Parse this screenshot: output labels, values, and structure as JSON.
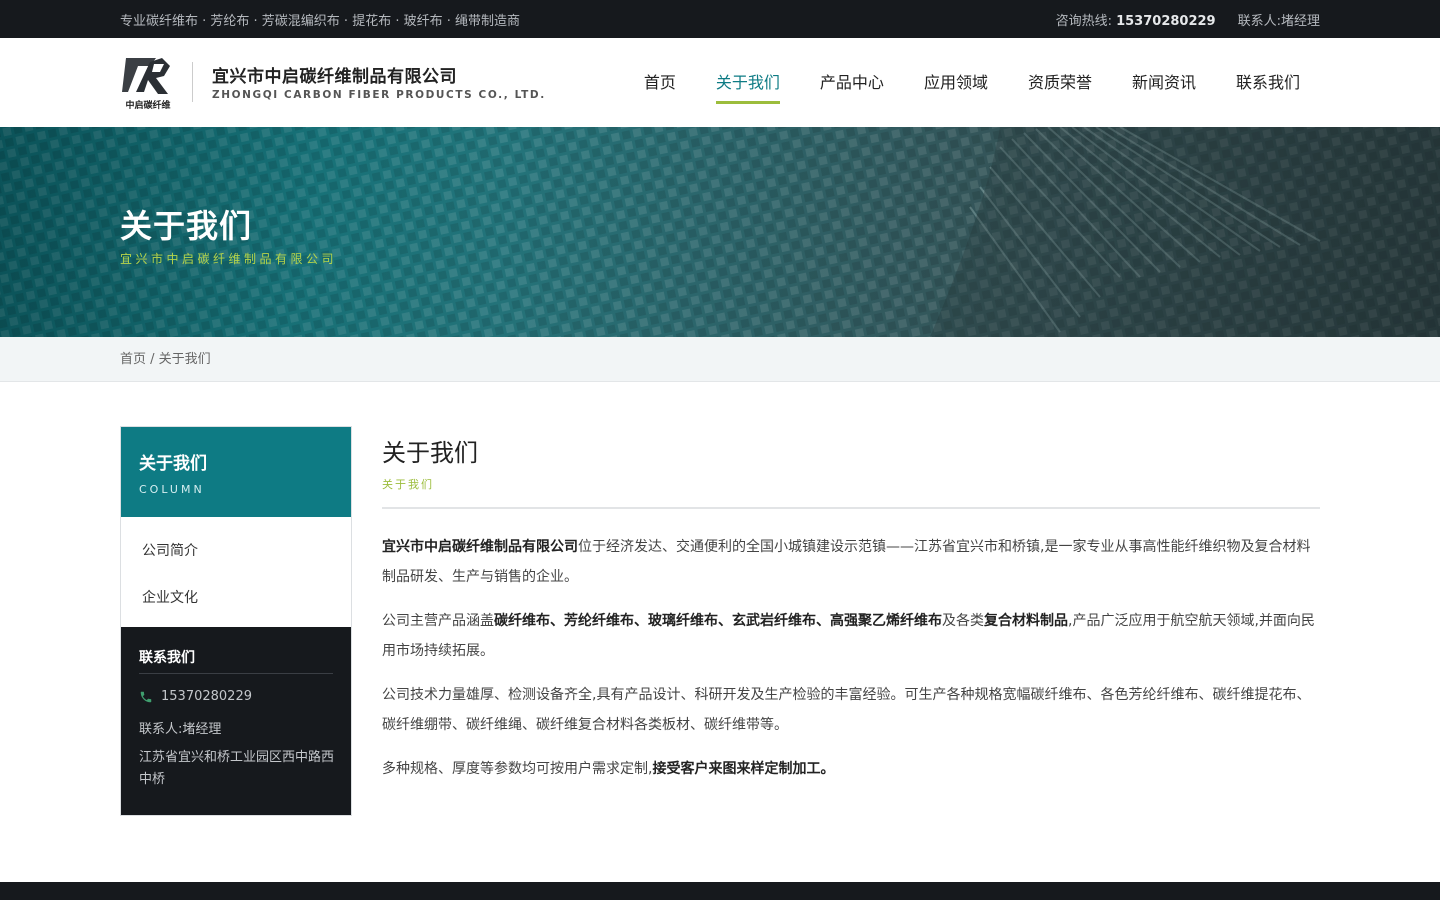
{
  "topbar": {
    "tagline": "专业碳纤维布 · 芳纶布 · 芳碳混编织布 · 提花布 · 玻纤布 · 绳带制造商",
    "hotline_label": "咨询热线:",
    "hotline_number": "15370280229",
    "contact_label": "联系人:",
    "contact_name": "堵经理"
  },
  "header": {
    "logo_caption": "中启碳纤维",
    "company_cn": "宜兴市中启碳纤维制品有限公司",
    "company_en": "ZHONGQI CARBON FIBER PRODUCTS CO., LTD.",
    "nav": [
      {
        "label": "首页",
        "active": false
      },
      {
        "label": "关于我们",
        "active": true
      },
      {
        "label": "产品中心",
        "active": false
      },
      {
        "label": "应用领域",
        "active": false
      },
      {
        "label": "资质荣誉",
        "active": false
      },
      {
        "label": "新闻资讯",
        "active": false
      },
      {
        "label": "联系我们",
        "active": false
      }
    ]
  },
  "banner": {
    "title": "关于我们",
    "subtitle": "宜兴市中启碳纤维制品有限公司"
  },
  "breadcrumb": {
    "home": "首页",
    "separator": " / ",
    "current": "关于我们"
  },
  "sidebar": {
    "title": "关于我们",
    "title_en": "COLUMN",
    "links": [
      "公司简介",
      "企业文化"
    ],
    "contact": {
      "title": "联系我们",
      "phone": "15370280229",
      "person": "联系人:堵经理",
      "address": "江苏省宜兴和桥工业园区西中路西中桥"
    }
  },
  "main": {
    "title": "关于我们",
    "subtitle": "关于我们",
    "p1": {
      "company": "宜兴市中启碳纤维制品有限公司",
      "text": "位于经济发达、交通便利的全国小城镇建设示范镇——江苏省宜兴市和桥镇,是一家专业从事高性能纤维织物及复合材料制品研发、生产与销售的企业。"
    },
    "p2": {
      "pre": "公司主营产品涵盖",
      "products": "碳纤维布、芳纶纤维布、玻璃纤维布、玄武岩纤维布、高强聚乙烯纤维布",
      "mid": "及各类",
      "composite": "复合材料制品",
      "post": ",产品广泛应用于航空航天领域,并面向民用市场持续拓展。"
    },
    "p3": "公司技术力量雄厚、检测设备齐全,具有产品设计、科研开发及生产检验的丰富经验。可生产各种规格宽幅碳纤维布、各色芳纶纤维布、碳纤维提花布、碳纤维绷带、碳纤维绳、碳纤维复合材料各类板材、碳纤维带等。",
    "p4": {
      "text": "多种规格、厚度等参数均可按用户需求定制,",
      "bold": "接受客户来图来样定制加工。"
    }
  },
  "colors": {
    "accent_teal": "#0e7b84",
    "accent_green": "#9cbd3c",
    "dark": "#16191d"
  }
}
